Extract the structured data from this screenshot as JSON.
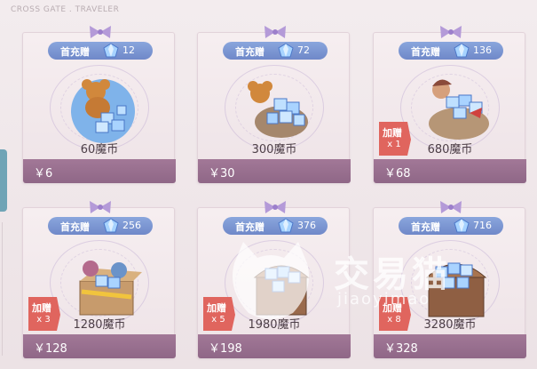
{
  "header": {
    "title": "CROSS GATE . TRAVELER"
  },
  "badge_label": "首充赠",
  "bonus_label": "加赠",
  "products": [
    {
      "name": "60魔币",
      "price": "￥6",
      "first_bonus": "12",
      "extra_bonus": ""
    },
    {
      "name": "300魔币",
      "price": "￥30",
      "first_bonus": "72",
      "extra_bonus": ""
    },
    {
      "name": "680魔币",
      "price": "￥68",
      "first_bonus": "136",
      "extra_bonus": "x 1"
    },
    {
      "name": "1280魔币",
      "price": "￥128",
      "first_bonus": "256",
      "extra_bonus": "x 3"
    },
    {
      "name": "1980魔币",
      "price": "￥198",
      "first_bonus": "376",
      "extra_bonus": "x 5"
    },
    {
      "name": "3280魔币",
      "price": "￥328",
      "first_bonus": "716",
      "extra_bonus": "x 8"
    }
  ],
  "watermark": {
    "cn": "交易猫",
    "en": "jiaoyimao"
  },
  "colors": {
    "badge": "#7e97d4",
    "price_bar": "#9a7092",
    "bonus_tag": "#e0655e"
  }
}
